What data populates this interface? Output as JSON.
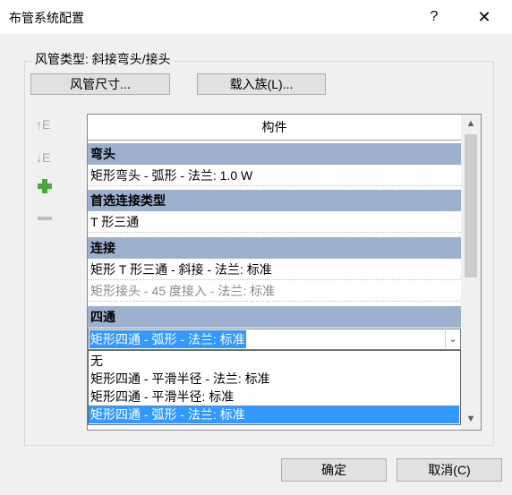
{
  "window": {
    "title": "布管系统配置",
    "help": "?",
    "close": "✕"
  },
  "duct_type_label": "风管类型: 斜接弯头/接头",
  "buttons": {
    "duct_size": "风管尺寸...",
    "load_family": "载入族(L)...",
    "ok": "确定",
    "cancel": "取消(C)"
  },
  "side_icons": {
    "move_up": "↑E",
    "move_down": "↓E"
  },
  "table": {
    "header": "构件",
    "sections": [
      {
        "category": "弯头",
        "items": [
          "矩形弯头 - 弧形 - 法兰: 1.0 W"
        ]
      },
      {
        "category": "首选连接类型",
        "items": [
          "T 形三通"
        ]
      },
      {
        "category": "连接",
        "items": [
          "矩形 T 形三通 - 斜接 - 法兰: 标准",
          "矩形接头 - 45 度接入 - 法兰: 标准"
        ]
      },
      {
        "category": "四通",
        "items": []
      }
    ]
  },
  "combo": {
    "selected": "矩形四通 - 弧形 - 法兰: 标准",
    "options": [
      "无",
      "矩形四通 - 平滑半径 - 法兰: 标准",
      "矩形四通 - 平滑半径: 标准",
      "矩形四通 - 弧形 - 法兰: 标准"
    ],
    "selected_index": 3
  },
  "scroll_arrows": {
    "up": "▲",
    "down": "▼",
    "combo": "⌄"
  }
}
